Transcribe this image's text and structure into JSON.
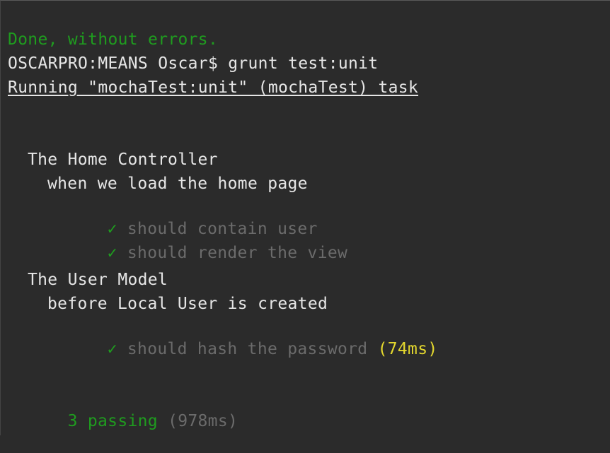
{
  "terminal": {
    "done_line": "Done, without errors.",
    "prompt": "OSCARPRO:MEANS Oscar$ grunt test:unit",
    "running_task": "Running \"mochaTest:unit\" (mochaTest) task",
    "suites": [
      {
        "title": "The Home Controller",
        "context": "when we load the home page",
        "tests": [
          {
            "check": "✓",
            "name": "should contain user"
          },
          {
            "check": "✓",
            "name": "should render the view"
          }
        ]
      },
      {
        "title": "The User Model",
        "context": "before Local User is created",
        "tests": [
          {
            "check": "✓",
            "name": "should hash the password",
            "duration": "(74ms)"
          }
        ]
      }
    ],
    "summary": {
      "passing": "3 passing",
      "total_time": "(978ms)"
    },
    "colors": {
      "background": "#2b2b2b",
      "text": "#e6e6e6",
      "success": "#1f9c1f",
      "dim": "#6b6b6b",
      "slow": "#e4d82e"
    }
  }
}
